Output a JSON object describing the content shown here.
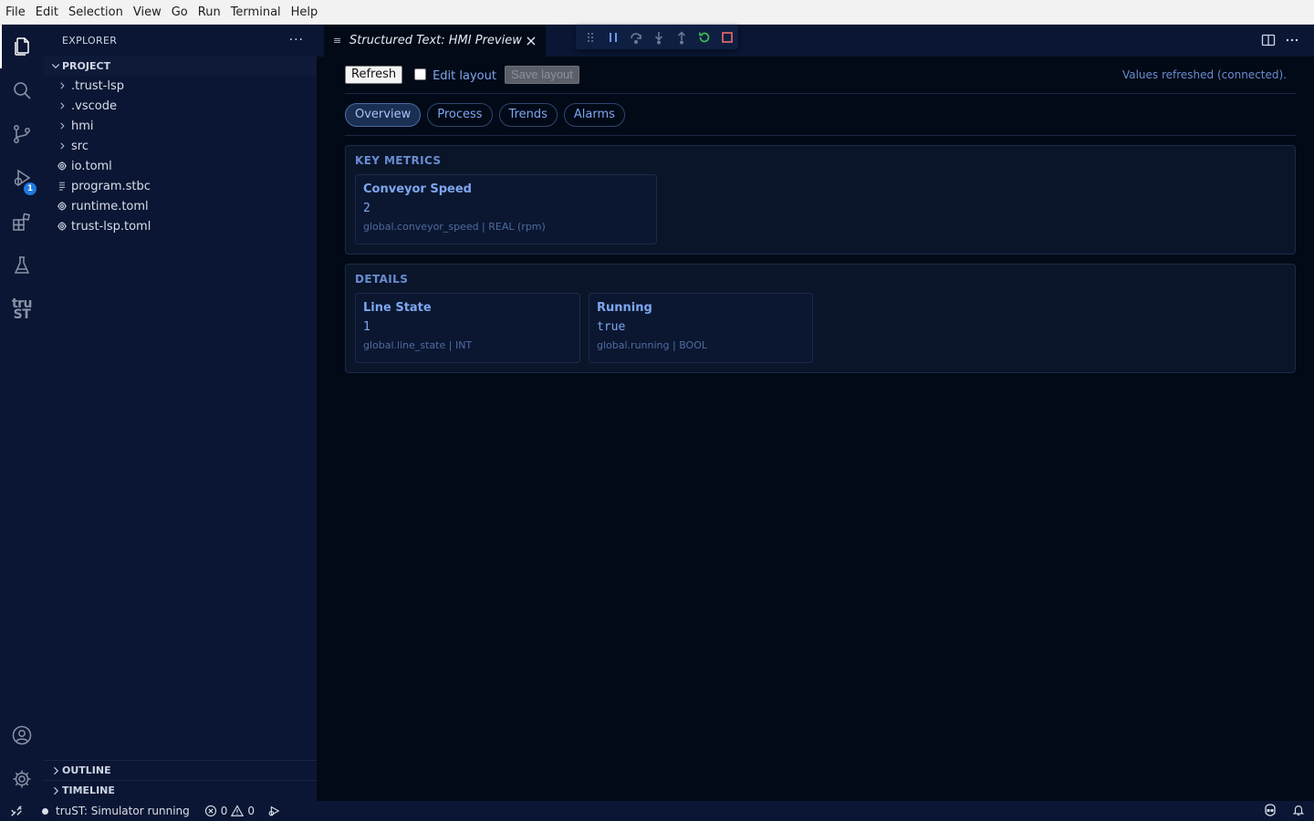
{
  "menu": [
    "File",
    "Edit",
    "Selection",
    "View",
    "Go",
    "Run",
    "Terminal",
    "Help"
  ],
  "activity_bar": {
    "run_debug_badge": "1",
    "tru_logo": [
      "tru",
      "ST"
    ]
  },
  "sidebar": {
    "title": "EXPLORER",
    "more": "···",
    "project_label": "PROJECT",
    "tree": [
      {
        "name": ".trust-lsp",
        "kind": "folder"
      },
      {
        "name": ".vscode",
        "kind": "folder"
      },
      {
        "name": "hmi",
        "kind": "folder"
      },
      {
        "name": "src",
        "kind": "folder"
      },
      {
        "name": "io.toml",
        "kind": "settings"
      },
      {
        "name": "program.stbc",
        "kind": "file"
      },
      {
        "name": "runtime.toml",
        "kind": "settings"
      },
      {
        "name": "trust-lsp.toml",
        "kind": "settings"
      }
    ],
    "outline_label": "OUTLINE",
    "timeline_label": "TIMELINE"
  },
  "editor": {
    "tab_title": "Structured Text: HMI Preview"
  },
  "hmi": {
    "refresh_label": "Refresh",
    "edit_layout_label": "Edit layout",
    "save_layout_label": "Save layout",
    "status": "Values refreshed (connected).",
    "tabs": [
      "Overview",
      "Process",
      "Trends",
      "Alarms"
    ],
    "active_tab": "Overview",
    "sections": [
      {
        "title": "KEY METRICS",
        "cards": [
          {
            "title": "Conveyor Speed",
            "value": "2",
            "meta": "global.conveyor_speed | REAL (rpm)"
          }
        ]
      },
      {
        "title": "DETAILS",
        "cards": [
          {
            "title": "Line State",
            "value": "1",
            "meta": "global.line_state | INT"
          },
          {
            "title": "Running",
            "value": "true",
            "meta": "global.running | BOOL"
          }
        ]
      }
    ]
  },
  "statusbar": {
    "simulator": "truST: Simulator running",
    "errors": "0",
    "warnings": "0"
  },
  "colors": {
    "accent": "#7ea6f0",
    "background": "#020a17",
    "sidebar": "#0a1633",
    "badge": "#1f7ae0"
  }
}
